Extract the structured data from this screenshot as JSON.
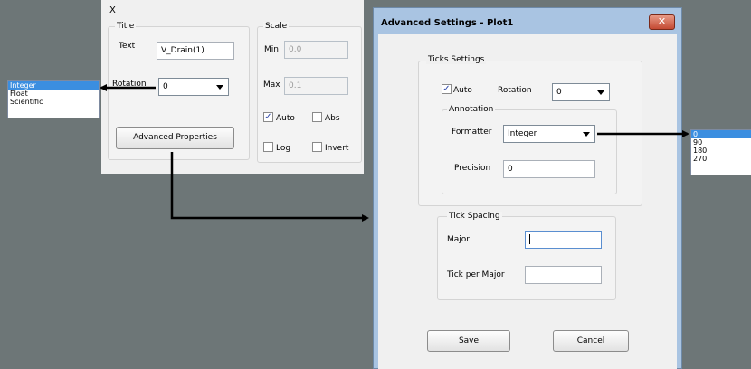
{
  "x_panel": {
    "header": "X",
    "title_group": {
      "label": "Title",
      "text_label": "Text",
      "text_value": "V_Drain(1)",
      "rotation_label": "Rotation",
      "rotation_value": "0"
    },
    "advanced_button": "Advanced Properties",
    "scale_group": {
      "label": "Scale",
      "min_label": "Min",
      "min_value": "0.0",
      "max_label": "Max",
      "max_value": "0.1",
      "auto_label": "Auto",
      "auto_checked": true,
      "abs_label": "Abs",
      "log_label": "Log",
      "invert_label": "Invert"
    }
  },
  "formatter_list": {
    "items": [
      "Integer",
      "Float",
      "Scientific"
    ],
    "selected": "Integer"
  },
  "rotation_list": {
    "items": [
      "0",
      "90",
      "180",
      "270"
    ],
    "selected": "0"
  },
  "dialog": {
    "title": "Advanced Settings - Plot1",
    "close_glyph": "✕",
    "ticks": {
      "label": "Ticks Settings",
      "auto_label": "Auto",
      "auto_checked": true,
      "rotation_label": "Rotation",
      "rotation_value": "0",
      "annotation": {
        "label": "Annotation",
        "formatter_label": "Formatter",
        "formatter_value": "Integer",
        "precision_label": "Precision",
        "precision_value": "0"
      }
    },
    "spacing": {
      "label": "Tick Spacing",
      "major_label": "Major",
      "major_value": "",
      "per_major_label": "Tick per Major",
      "per_major_value": ""
    },
    "save_label": "Save",
    "cancel_label": "Cancel"
  },
  "colors": {
    "background": "#6d7677",
    "dialog_frame": "#a9c4e2",
    "selection": "#3b8ee0",
    "close_button": "#c44a33"
  }
}
